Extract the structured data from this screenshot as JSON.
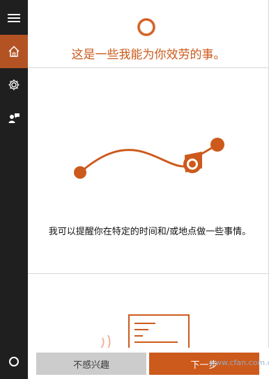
{
  "accent_color": "#cc5a1c",
  "sidebar": {
    "items": [
      {
        "name": "menu",
        "icon": "hamburger-icon"
      },
      {
        "name": "home",
        "icon": "home-icon"
      },
      {
        "name": "settings",
        "icon": "gear-icon"
      },
      {
        "name": "feedback",
        "icon": "feedback-icon"
      },
      {
        "name": "cortana",
        "icon": "cortana-ring-icon"
      }
    ]
  },
  "header": {
    "title": "这是一些我能为你效劳的事。"
  },
  "card": {
    "description": "我可以提醒你在特定的时间和/或地点做一些事情。"
  },
  "footer": {
    "skip_label": "不感兴趣",
    "next_label": "下一步"
  },
  "watermark": {
    "text": "www.cfan.com.cn"
  }
}
